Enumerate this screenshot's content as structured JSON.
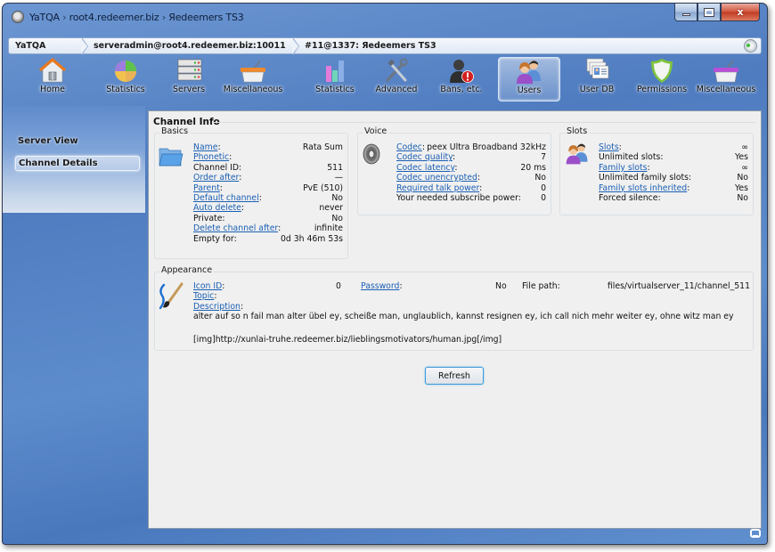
{
  "window": {
    "title_parts": [
      "YaTQA",
      "root4.redeemer.biz",
      "Яedeemers TS3"
    ],
    "title_separator": "›",
    "controls": {
      "minimize": "minimize",
      "maximize": "maximize",
      "close": "x"
    }
  },
  "breadcrumb": [
    "YaTQA",
    "serveradmin@root4.redeemer.biz:10011",
    "#11@1337: Яedeemers TS3"
  ],
  "toolbar": [
    {
      "label": "Home",
      "icon": "home-icon"
    },
    {
      "label": "Statistics",
      "icon": "pie-chart-icon"
    },
    {
      "label": "Servers",
      "icon": "servers-icon"
    },
    {
      "label": "Miscellaneous",
      "icon": "basket-icon"
    },
    {
      "label": "Statistics",
      "icon": "bar-chart-icon"
    },
    {
      "label": "Advanced",
      "icon": "tools-icon"
    },
    {
      "label": "Bans, etc.",
      "icon": "ban-user-icon"
    },
    {
      "label": "Users",
      "icon": "users-icon",
      "active": true
    },
    {
      "label": "User DB",
      "icon": "user-cards-icon"
    },
    {
      "label": "Permissions",
      "icon": "shield-icon"
    },
    {
      "label": "Miscellaneous",
      "icon": "basket-purple-icon"
    }
  ],
  "sidebar": {
    "items": [
      {
        "label": "Server View",
        "selected": false
      },
      {
        "label": "Channel Details",
        "selected": true
      }
    ]
  },
  "channel_info": {
    "title": "Channel Info",
    "basics": {
      "label": "Basics",
      "rows": [
        {
          "key": "Name",
          "link": true,
          "value": "Rata Sum"
        },
        {
          "key": "Phonetic",
          "link": true,
          "value": ""
        },
        {
          "key": "Channel ID",
          "link": false,
          "value": "511"
        },
        {
          "key": "Order after",
          "link": true,
          "value": "—"
        },
        {
          "key": "Parent",
          "link": true,
          "value": "PvE (510)"
        },
        {
          "key": "Default channel",
          "link": true,
          "value": "No"
        },
        {
          "key": "Auto delete",
          "link": true,
          "value": "never"
        },
        {
          "key": "Private",
          "link": false,
          "value": "No"
        },
        {
          "key": "Delete channel after",
          "link": true,
          "value": "infinite"
        },
        {
          "key": "Empty for",
          "link": false,
          "value": "0d 3h 46m 53s"
        }
      ]
    },
    "voice": {
      "label": "Voice",
      "rows": [
        {
          "key": "Codec",
          "link": true,
          "value": "peex Ultra Broadband 32kHz"
        },
        {
          "key": "Codec quality",
          "link": true,
          "value": "7"
        },
        {
          "key": "Codec latency",
          "link": true,
          "value": "20 ms"
        },
        {
          "key": "Codec unencrypted",
          "link": true,
          "value": "No"
        },
        {
          "key": "Required talk power",
          "link": true,
          "value": "0"
        },
        {
          "key": "Your needed subscribe power",
          "link": false,
          "value": "0"
        }
      ]
    },
    "slots": {
      "label": "Slots",
      "rows": [
        {
          "key": "Slots",
          "link": true,
          "value": "∞"
        },
        {
          "key": "Unlimited slots",
          "link": false,
          "value": "Yes"
        },
        {
          "key": "Family slots",
          "link": true,
          "value": "∞"
        },
        {
          "key": "Unlimited family slots",
          "link": false,
          "value": "No"
        },
        {
          "key": "Family slots inherited",
          "link": true,
          "value": "Yes"
        },
        {
          "key": "Forced silence",
          "link": false,
          "value": "No"
        }
      ]
    },
    "appearance": {
      "label": "Appearance",
      "icon_id_label": "Icon ID",
      "icon_id_value": "0",
      "password_label": "Password",
      "password_value": "No",
      "file_path_label": "File path:",
      "file_path_value": "files/virtualserver_11/channel_511",
      "topic_label": "Topic",
      "topic_value": "",
      "description_label": "Description",
      "description_lines": [
        "alter auf so n fail man alter übel ey, scheiße man, unglaublich, kannst resignen ey, ich call nich mehr weiter ey, ohne witz man ey",
        "",
        "[img]http://xunlai-truhe.redeemer.biz/lieblingsmotivators/human.jpg[/img]"
      ]
    },
    "refresh_label": "Refresh"
  },
  "colors": {
    "link": "#1a5fb4",
    "window_frame": "#4f7cc0",
    "content_bg": "#efefef",
    "close_button": "#c23b22"
  }
}
